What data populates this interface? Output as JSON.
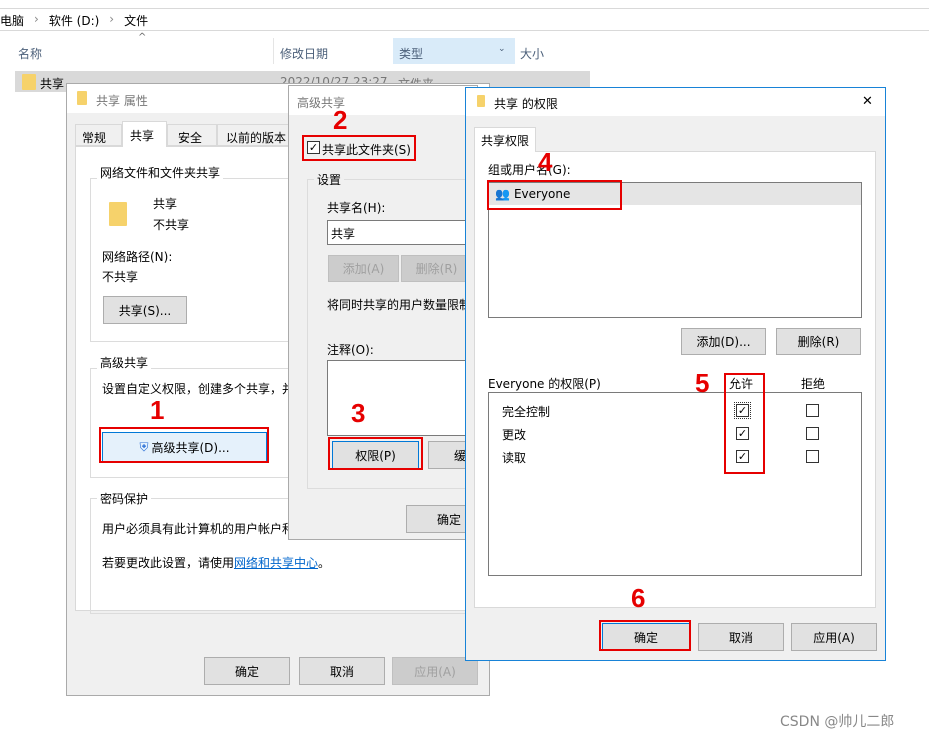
{
  "explorer": {
    "breadcrumb": [
      "电脑",
      "软件 (D:)",
      "文件"
    ],
    "columns": {
      "name": "名称",
      "modified": "修改日期",
      "type": "类型",
      "size": "大小"
    },
    "row": {
      "name": "共享",
      "modified": "2022/10/27 23:27",
      "type": "文件夹"
    }
  },
  "properties": {
    "title": "共享 属性",
    "tabs": [
      "常规",
      "共享",
      "安全",
      "以前的版本"
    ],
    "group1": "网络文件和文件夹共享",
    "folder_name": "共享",
    "status": "不共享",
    "path_label": "网络路径(N):",
    "path_value": "不共享",
    "share_button": "共享(S)...",
    "group2": "高级共享",
    "adv_desc": "设置自定义权限，创建多个共享，并",
    "adv_button": "高级共享(D)...",
    "group3": "密码保护",
    "pwd_desc": "用户必须具有此计算机的用户帐户和",
    "pwd_change": "若要更改此设置，请使用",
    "pwd_link": "网络和共享中心",
    "pwd_end": "。",
    "ok": "确定",
    "cancel": "取消",
    "apply": "应用(A)"
  },
  "advanced": {
    "title": "高级共享",
    "share_checkbox": "共享此文件夹(S)",
    "share_checked": true,
    "settings": "设置",
    "share_name_label": "共享名(H):",
    "share_name": "共享",
    "add": "添加(A)",
    "remove": "删除(R)",
    "limit": "将同时共享的用户数量限制",
    "comment": "注释(O):",
    "permissions": "权限(P)",
    "cache": "缓",
    "ok": "确定"
  },
  "permissions": {
    "title": "共享 的权限",
    "tab": "共享权限",
    "group_label": "组或用户名(G):",
    "users": [
      "Everyone"
    ],
    "add": "添加(D)...",
    "remove": "删除(R)",
    "perm_label": "Everyone 的权限(P)",
    "allow": "允许",
    "deny": "拒绝",
    "rows": [
      {
        "name": "完全控制",
        "allow": true,
        "deny": false
      },
      {
        "name": "更改",
        "allow": true,
        "deny": false
      },
      {
        "name": "读取",
        "allow": true,
        "deny": false
      }
    ],
    "ok": "确定",
    "cancel": "取消",
    "apply": "应用(A)",
    "close": "✕"
  },
  "annotations": [
    "1",
    "2",
    "3",
    "4",
    "5",
    "6"
  ],
  "watermark": "CSDN @帅儿二郎",
  "colors": {
    "accent": "#0078d7",
    "annotation": "#e60000"
  }
}
